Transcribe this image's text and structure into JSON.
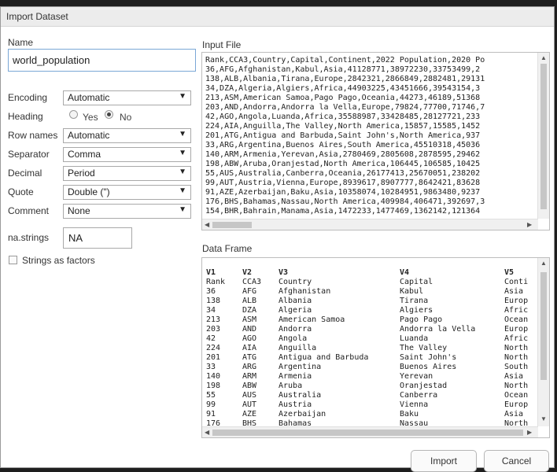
{
  "dialog": {
    "title": "Import Dataset"
  },
  "options": {
    "name_label": "Name",
    "name_value": "world_population",
    "encoding_label": "Encoding",
    "encoding_value": "Automatic",
    "heading_label": "Heading",
    "heading_yes": "Yes",
    "heading_no": "No",
    "heading_selected": "No",
    "rownames_label": "Row names",
    "rownames_value": "Automatic",
    "separator_label": "Separator",
    "separator_value": "Comma",
    "decimal_label": "Decimal",
    "decimal_value": "Period",
    "quote_label": "Quote",
    "quote_value": "Double (\")",
    "comment_label": "Comment",
    "comment_value": "None",
    "nastrings_label": "na.strings",
    "nastrings_value": "NA",
    "strings_as_factors_label": "Strings as factors",
    "strings_as_factors_checked": false
  },
  "input_file": {
    "label": "Input File",
    "lines": [
      "Rank,CCA3,Country,Capital,Continent,2022 Population,2020 Po",
      "36,AFG,Afghanistan,Kabul,Asia,41128771,38972230,33753499,2",
      "138,ALB,Albania,Tirana,Europe,2842321,2866849,2882481,29131",
      "34,DZA,Algeria,Algiers,Africa,44903225,43451666,39543154,3",
      "213,ASM,American Samoa,Pago Pago,Oceania,44273,46189,51368",
      "203,AND,Andorra,Andorra la Vella,Europe,79824,77700,71746,7",
      "42,AGO,Angola,Luanda,Africa,35588987,33428485,28127721,233",
      "224,AIA,Anguilla,The Valley,North America,15857,15585,1452",
      "201,ATG,Antigua and Barbuda,Saint John's,North America,937",
      "33,ARG,Argentina,Buenos Aires,South America,45510318,45036",
      "140,ARM,Armenia,Yerevan,Asia,2780469,2805608,2878595,29462",
      "198,ABW,Aruba,Oranjestad,North America,106445,106585,10425",
      "55,AUS,Australia,Canberra,Oceania,26177413,25670051,238202",
      "99,AUT,Austria,Vienna,Europe,8939617,8907777,8642421,83628",
      "91,AZE,Azerbaijan,Baku,Asia,10358074,10284951,9863480,9237",
      "176,BHS,Bahamas,Nassau,North America,409984,406471,392697,3",
      "154,BHR,Bahrain,Manama,Asia,1472233,1477469,1362142,121364"
    ]
  },
  "data_frame": {
    "label": "Data Frame",
    "columns": [
      "V1",
      "V2",
      "V3",
      "V4",
      "V5"
    ],
    "rows": [
      [
        "Rank",
        "CCA3",
        "Country",
        "Capital",
        "Conti"
      ],
      [
        "36",
        "AFG",
        "Afghanistan",
        "Kabul",
        "Asia"
      ],
      [
        "138",
        "ALB",
        "Albania",
        "Tirana",
        "Europ"
      ],
      [
        "34",
        "DZA",
        "Algeria",
        "Algiers",
        "Afric"
      ],
      [
        "213",
        "ASM",
        "American Samoa",
        "Pago Pago",
        "Ocean"
      ],
      [
        "203",
        "AND",
        "Andorra",
        "Andorra la Vella",
        "Europ"
      ],
      [
        "42",
        "AGO",
        "Angola",
        "Luanda",
        "Afric"
      ],
      [
        "224",
        "AIA",
        "Anguilla",
        "The Valley",
        "North"
      ],
      [
        "201",
        "ATG",
        "Antigua and Barbuda",
        "Saint John's",
        "North"
      ],
      [
        "33",
        "ARG",
        "Argentina",
        "Buenos Aires",
        "South"
      ],
      [
        "140",
        "ARM",
        "Armenia",
        "Yerevan",
        "Asia"
      ],
      [
        "198",
        "ABW",
        "Aruba",
        "Oranjestad",
        "North"
      ],
      [
        "55",
        "AUS",
        "Australia",
        "Canberra",
        "Ocean"
      ],
      [
        "99",
        "AUT",
        "Austria",
        "Vienna",
        "Europ"
      ],
      [
        "91",
        "AZE",
        "Azerbaijan",
        "Baku",
        "Asia"
      ],
      [
        "176",
        "BHS",
        "Bahamas",
        "Nassau",
        "North"
      ]
    ]
  },
  "buttons": {
    "import": "Import",
    "cancel": "Cancel"
  },
  "icons": {
    "dropdown": "chevron-down-icon",
    "scroll_up": "scroll-up-icon",
    "scroll_down": "scroll-down-icon",
    "scroll_left": "scroll-left-icon",
    "scroll_right": "scroll-right-icon"
  }
}
